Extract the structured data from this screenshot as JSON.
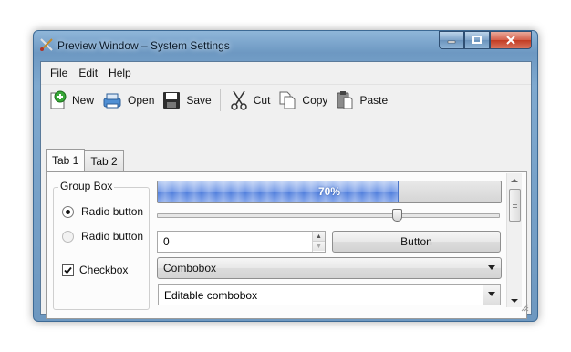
{
  "window": {
    "title": "Preview Window – System Settings"
  },
  "menu": [
    "File",
    "Edit",
    "Help"
  ],
  "toolbar": {
    "new": "New",
    "open": "Open",
    "save": "Save",
    "cut": "Cut",
    "copy": "Copy",
    "paste": "Paste"
  },
  "tabs": [
    "Tab 1",
    "Tab 2"
  ],
  "group": {
    "title": "Group Box",
    "radio1": {
      "label": "Radio button",
      "checked": true
    },
    "radio2": {
      "label": "Radio button",
      "enabled": false
    },
    "checkbox": {
      "label": "Checkbox",
      "checked": true
    }
  },
  "progress": {
    "text": "70%",
    "value": 0.7,
    "color": "#5f87e0"
  },
  "slider": {
    "value": 0.7
  },
  "spinbox": {
    "value": "0"
  },
  "button": {
    "label": "Button"
  },
  "combobox": {
    "value": "Combobox"
  },
  "editable_combobox": {
    "value": "Editable combobox"
  },
  "scrollbar": {
    "thumb_fraction": 0.0
  }
}
